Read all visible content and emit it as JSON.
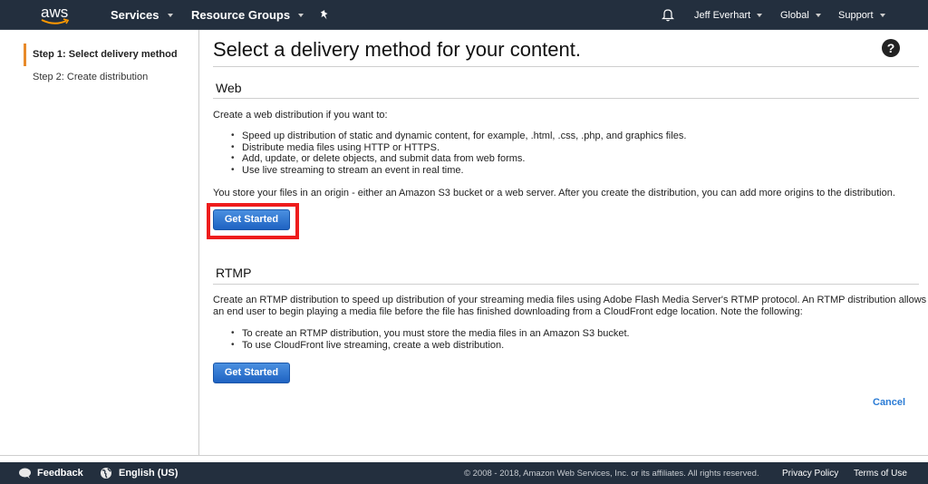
{
  "topbar": {
    "logo_text": "aws",
    "services_label": "Services",
    "resource_groups_label": "Resource Groups",
    "pin_icon": "pushpin-icon",
    "bell_icon": "bell-icon",
    "user_label": "Jeff Everhart",
    "region_label": "Global",
    "support_label": "Support"
  },
  "sidebar": {
    "steps": [
      {
        "label": "Step 1: Select delivery method",
        "active": true
      },
      {
        "label": "Step 2: Create distribution",
        "active": false
      }
    ]
  },
  "main": {
    "title": "Select a delivery method for your content.",
    "help_icon": "?",
    "web": {
      "heading": "Web",
      "intro": "Create a web distribution if you want to:",
      "bullets": [
        "Speed up distribution of static and dynamic content, for example, .html, .css, .php, and graphics files.",
        "Distribute media files using HTTP or HTTPS.",
        "Add, update, or delete objects, and submit data from web forms.",
        "Use live streaming to stream an event in real time."
      ],
      "origin_note": "You store your files in an origin - either an Amazon S3 bucket or a web server. After you create the distribution, you can add more origins to the distribution.",
      "button_label": "Get Started"
    },
    "rtmp": {
      "heading": "RTMP",
      "intro": "Create an RTMP distribution to speed up distribution of your streaming media files using Adobe Flash Media Server's RTMP protocol. An RTMP distribution allows an end user to begin playing a media file before the file has finished downloading from a CloudFront edge location. Note the following:",
      "bullets": [
        "To create an RTMP distribution, you must store the media files in an Amazon S3 bucket.",
        "To use CloudFront live streaming, create a web distribution."
      ],
      "button_label": "Get Started"
    },
    "cancel_label": "Cancel"
  },
  "footer": {
    "feedback_label": "Feedback",
    "language_label": "English (US)",
    "copyright": "© 2008 - 2018, Amazon Web Services, Inc. or its affiliates. All rights reserved.",
    "privacy_label": "Privacy Policy",
    "terms_label": "Terms of Use"
  },
  "colors": {
    "topbar_bg": "#232f3e",
    "accent_orange": "#e88a2a",
    "button_blue": "#1f63c2",
    "link_blue": "#2a7bd5",
    "highlight_red": "#ee1c1c"
  }
}
